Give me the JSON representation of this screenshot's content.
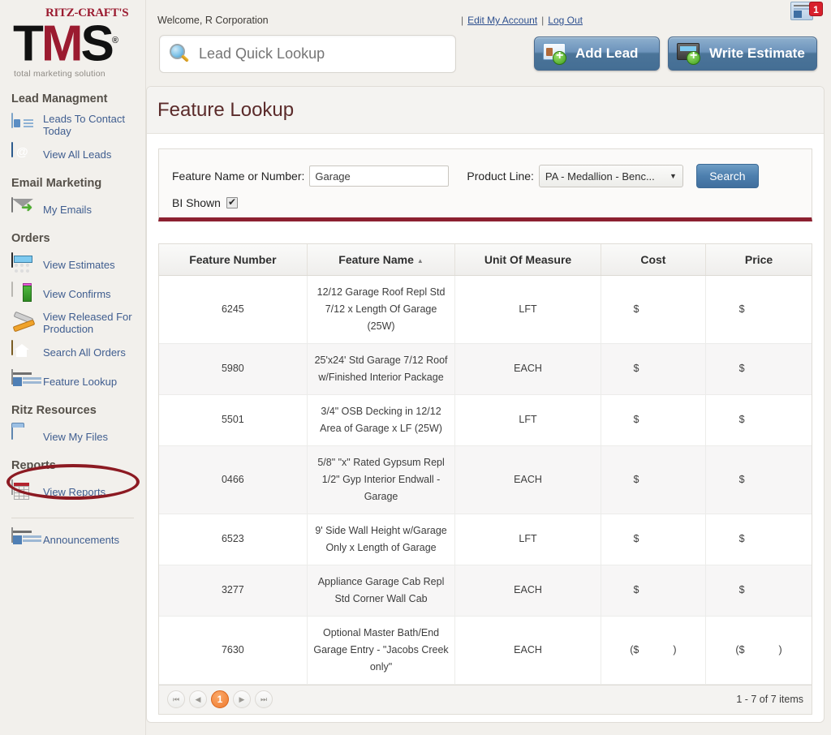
{
  "brand": {
    "logo_top": "RITZ-CRAFT'S",
    "logo_t": "T",
    "logo_m": "M",
    "logo_s": "S",
    "logo_reg": "®",
    "tagline": "total marketing solution"
  },
  "header": {
    "welcome": "Welcome, R Corporation",
    "sep1": "|",
    "edit_account": "Edit My Account",
    "sep2": "|",
    "log_out": "Log Out",
    "quick_lookup_placeholder": "Lead Quick Lookup",
    "quick_lookup_value": "",
    "add_lead": "Add Lead",
    "write_estimate": "Write Estimate",
    "announcement_count": "1"
  },
  "sidebar": {
    "groups": [
      {
        "title": "Lead Managment",
        "items": [
          {
            "label": "Leads To Contact Today",
            "icon": "contact-card-icon"
          },
          {
            "label": "View All Leads",
            "icon": "address-book-icon"
          }
        ]
      },
      {
        "title": "Email Marketing",
        "items": [
          {
            "label": "My Emails",
            "icon": "envelope-icon"
          }
        ]
      },
      {
        "title": "Orders",
        "items": [
          {
            "label": "View Estimates",
            "icon": "calculator-icon"
          },
          {
            "label": "View Confirms",
            "icon": "confirm-icon"
          },
          {
            "label": "View Released For Production",
            "icon": "tools-icon"
          },
          {
            "label": "Search All Orders",
            "icon": "home-folder-icon"
          },
          {
            "label": "Feature Lookup",
            "icon": "newspaper-icon"
          }
        ]
      },
      {
        "title": "Ritz Resources",
        "items": [
          {
            "label": "View My Files",
            "icon": "folder-icon"
          }
        ]
      },
      {
        "title": "Reports",
        "items": [
          {
            "label": "View Reports",
            "icon": "report-icon"
          }
        ]
      }
    ],
    "footer_items": [
      {
        "label": "Announcements",
        "icon": "announcement-icon"
      }
    ]
  },
  "main": {
    "page_title": "Feature Lookup",
    "search": {
      "feature_label": "Feature Name or Number:",
      "feature_value": "Garage",
      "product_line_label": "Product Line:",
      "product_line_value": "PA - Medallion - Benc...",
      "caret": "▼",
      "search_button": "Search",
      "bi_shown_label": "BI Shown",
      "bi_shown_checked": true
    },
    "table": {
      "columns": [
        {
          "label": "Feature Number",
          "sorted": ""
        },
        {
          "label": "Feature Name",
          "sorted": "▲"
        },
        {
          "label": "Unit Of Measure",
          "sorted": ""
        },
        {
          "label": "Cost",
          "sorted": ""
        },
        {
          "label": "Price",
          "sorted": ""
        }
      ],
      "rows": [
        {
          "number": "6245",
          "name": "12/12 Garage Roof Repl Std 7/12 x Length Of Garage (25W)",
          "uom": "LFT",
          "cost": "$",
          "price": "$"
        },
        {
          "number": "5980",
          "name": "25'x24' Std Garage 7/12 Roof w/Finished Interior Package",
          "uom": "EACH",
          "cost": "$",
          "price": "$"
        },
        {
          "number": "5501",
          "name": "3/4\" OSB Decking in 12/12 Area of Garage x LF (25W)",
          "uom": "LFT",
          "cost": "$",
          "price": "$"
        },
        {
          "number": "0466",
          "name": "5/8\" \"x\" Rated Gypsum Repl 1/2\" Gyp Interior Endwall - Garage",
          "uom": "EACH",
          "cost": "$",
          "price": "$"
        },
        {
          "number": "6523",
          "name": "9' Side Wall Height w/Garage Only x Length of Garage",
          "uom": "LFT",
          "cost": "$",
          "price": "$"
        },
        {
          "number": "3277",
          "name": "Appliance Garage Cab Repl Std Corner Wall Cab",
          "uom": "EACH",
          "cost": "$",
          "price": "$"
        },
        {
          "number": "7630",
          "name": "Optional Master Bath/End Garage Entry - \"Jacobs Creek only\"",
          "uom": "EACH",
          "cost": "($",
          "cost_suffix": ")",
          "price": "($",
          "price_suffix": ")"
        }
      ]
    },
    "pager": {
      "first": "⏮",
      "prev": "◀",
      "page": "1",
      "next": "▶",
      "last": "⏭",
      "info": "1 - 7 of 7 items"
    }
  }
}
